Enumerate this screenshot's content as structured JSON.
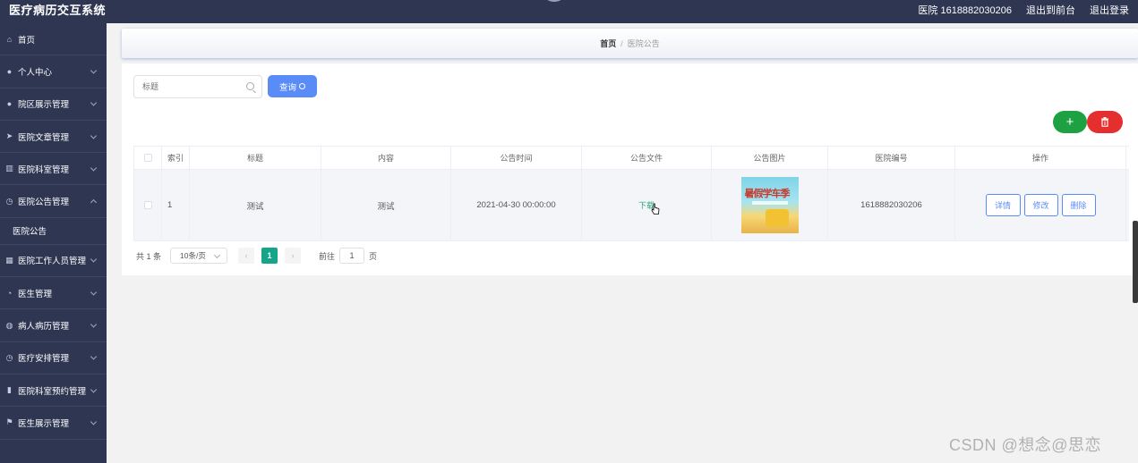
{
  "header": {
    "app_title": "医疗病历交互系统",
    "user_label": "医院 1618882030206",
    "to_frontend": "退出到前台",
    "logout": "退出登录"
  },
  "sidebar": {
    "items": [
      {
        "icon": "home-icon",
        "label": "首页"
      },
      {
        "icon": "user-icon",
        "label": "个人中心"
      },
      {
        "icon": "user-icon",
        "label": "院区展示管理"
      },
      {
        "icon": "send-icon",
        "label": "医院文章管理"
      },
      {
        "icon": "chart-icon",
        "label": "医院科室管理"
      },
      {
        "icon": "clock-icon",
        "label": "医院公告管理"
      },
      {
        "icon": "bank-icon",
        "label": "医院工作人员管理"
      },
      {
        "icon": "dashboard-icon",
        "label": "医生管理"
      },
      {
        "icon": "globe-icon",
        "label": "病人病历管理"
      },
      {
        "icon": "clock-icon",
        "label": "医疗安排管理"
      },
      {
        "icon": "trash-icon",
        "label": "医院科室预约管理"
      },
      {
        "icon": "flag-icon",
        "label": "医生展示管理"
      }
    ],
    "sub_item": "医院公告"
  },
  "breadcrumb": {
    "home": "首页",
    "separator": "/",
    "current": "医院公告"
  },
  "search": {
    "placeholder": "标题",
    "query_label": "查询"
  },
  "toolbar": {
    "add_label": "+"
  },
  "table": {
    "headers": [
      "索引",
      "标题",
      "内容",
      "公告时间",
      "公告文件",
      "公告图片",
      "医院编号",
      "操作"
    ],
    "rows": [
      {
        "index": "1",
        "title": "测试",
        "content": "测试",
        "time": "2021-04-30 00:00:00",
        "file_link": "下载",
        "image_text": "暑假学车季",
        "hospital_no": "1618882030206",
        "actions": {
          "detail": "详情",
          "edit": "修改",
          "delete": "删除"
        }
      }
    ]
  },
  "pagination": {
    "total": "共 1 条",
    "page_size": "10条/页",
    "prev": "‹",
    "current_page": "1",
    "next": "›",
    "goto_label": "前往",
    "goto_value": "1",
    "page_unit": "页"
  },
  "watermark": "CSDN @想念@思恋",
  "colors": {
    "sidebar": "#2e3652",
    "primary": "#5a8cf8",
    "success": "#1ea143",
    "danger": "#e52e2e",
    "page_active": "#17a58a"
  }
}
